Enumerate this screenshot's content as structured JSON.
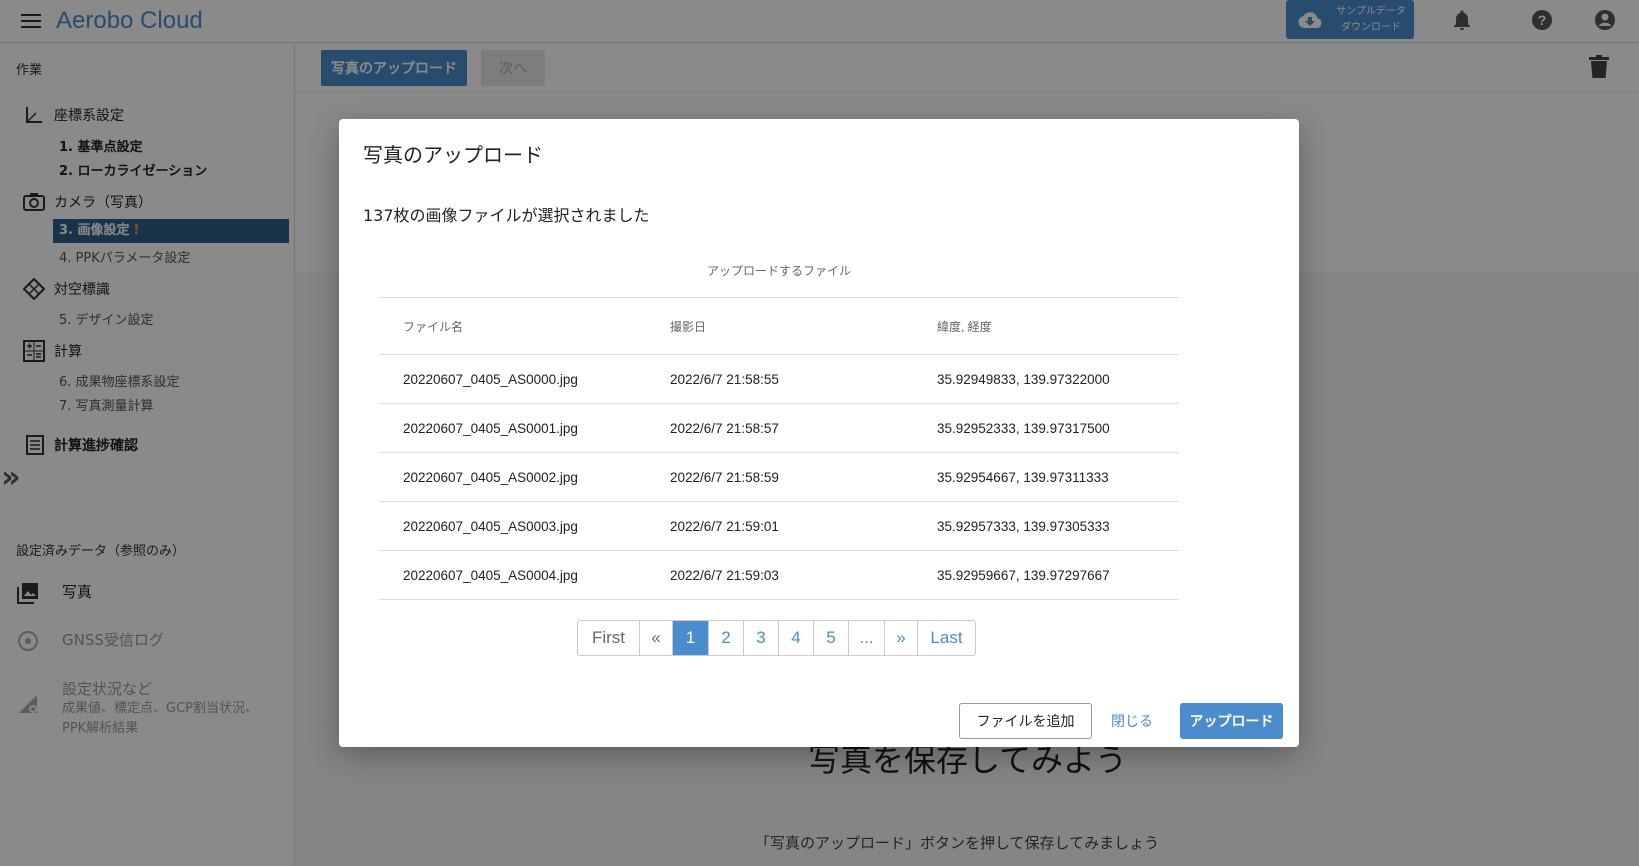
{
  "app": {
    "title": "Aerobo Cloud"
  },
  "topbar": {
    "sample_download_line1": "サンプルデータ",
    "sample_download_line2": "ダウンロード",
    "icons": [
      "menu-icon",
      "cloud-download-icon",
      "bell-icon",
      "help-icon",
      "account-icon"
    ]
  },
  "sidebar": {
    "section_work": "作業",
    "groups": [
      {
        "label": "座標系設定",
        "icon": "axis-icon"
      },
      {
        "label": "カメラ（写真）",
        "icon": "camera-icon"
      },
      {
        "label": "対空標識",
        "icon": "target-icon"
      },
      {
        "label": "計算",
        "icon": "calculator-icon"
      },
      {
        "label": "計算進捗確認",
        "icon": "list-icon"
      }
    ],
    "steps": [
      {
        "label": "1. 基準点設定"
      },
      {
        "label": "2. ローカライゼーション"
      },
      {
        "label": "3. 画像設定",
        "alert": "!"
      },
      {
        "label": "4. PPKパラメータ設定"
      },
      {
        "label": "5. デザイン設定"
      },
      {
        "label": "6. 成果物座標系設定"
      },
      {
        "label": "7. 写真測量計算"
      }
    ],
    "section_ref": "設定済みデータ（参照のみ）",
    "ref_items": [
      {
        "label": "写真",
        "icon": "photo-library-icon"
      },
      {
        "label": "GNSS受信ログ",
        "icon": "gnss-icon"
      },
      {
        "label": "設定状況など",
        "sub": "成果値、標定点、GCP割当状況、",
        "sub2": "PPK解析結果",
        "icon": "settings-status-icon"
      }
    ],
    "collapse_glyph": "»"
  },
  "toolbar": {
    "upload_label": "写真のアップロード",
    "next_label": "次へ"
  },
  "background": {
    "heading": "写真を保存してみよう",
    "sub": "「写真のアップロード」ボタンを押して保存してみましょう"
  },
  "dialog": {
    "title": "写真のアップロード",
    "count_text": "137枚の画像ファイルが選択されました",
    "table_caption": "アップロードするファイル",
    "columns": [
      "ファイル名",
      "撮影日",
      "緯度, 経度"
    ],
    "rows": [
      [
        "20220607_0405_AS0000.jpg",
        "2022/6/7 21:58:55",
        "35.92949833, 139.97322000"
      ],
      [
        "20220607_0405_AS0001.jpg",
        "2022/6/7 21:58:57",
        "35.92952333, 139.97317500"
      ],
      [
        "20220607_0405_AS0002.jpg",
        "2022/6/7 21:58:59",
        "35.92954667, 139.97311333"
      ],
      [
        "20220607_0405_AS0003.jpg",
        "2022/6/7 21:59:01",
        "35.92957333, 139.97305333"
      ],
      [
        "20220607_0405_AS0004.jpg",
        "2022/6/7 21:59:03",
        "35.92959667, 139.97297667"
      ]
    ],
    "pager": {
      "first": "First",
      "prev": "«",
      "pages": [
        "1",
        "2",
        "3",
        "4",
        "5"
      ],
      "active_page": "1",
      "more": "...",
      "next": "»",
      "last": "Last"
    },
    "add_files_label": "ファイルを追加",
    "close_label": "閉じる",
    "upload_label": "アップロード"
  },
  "colors": {
    "accent": "#4a8ccc",
    "active_step_bg": "#2e5f8a",
    "alert": "#f0a030"
  }
}
